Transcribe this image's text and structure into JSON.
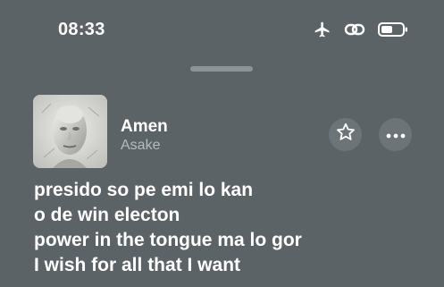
{
  "status_bar": {
    "time": "08:33",
    "icons": [
      "airplane-icon",
      "link-icon",
      "battery-icon"
    ]
  },
  "track": {
    "title": "Amen",
    "artist": "Asake",
    "artwork": "album-cover"
  },
  "actions": {
    "favorite_icon": "star-icon",
    "more_icon": "ellipsis-icon"
  },
  "lyrics": [
    "presido so pe emi lo kan",
    "o de win electon",
    "power in the tongue ma lo gor",
    "I wish for all that I want"
  ],
  "colors": {
    "background": "#5c6366",
    "text": "#ffffff",
    "secondary_text": "#b6bcbe",
    "button_bg": "#6d7477"
  }
}
